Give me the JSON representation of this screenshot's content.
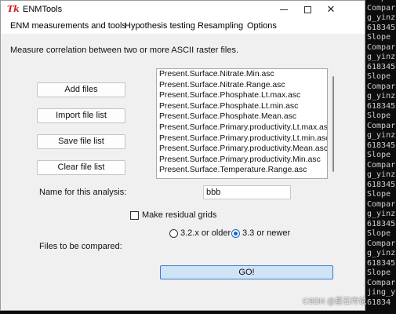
{
  "window": {
    "app_icon_glyph": "Tk",
    "title": "ENMTools",
    "controls": {
      "minimize": "—",
      "maximize": "☐",
      "close": "✕"
    }
  },
  "menu": [
    "ENM measurements and tools",
    "Hypothesis testing",
    "Resampling",
    "Options"
  ],
  "description": "Measure correlation between two or more ASCII raster files.",
  "buttons": {
    "add_files": "Add files",
    "import_file_list": "Import file list",
    "save_file_list": "Save file list",
    "clear_file_list": "Clear file list",
    "go": "GO!"
  },
  "file_list": [
    "Present.Surface.Nitrate.Min.asc",
    "Present.Surface.Nitrate.Range.asc",
    "Present.Surface.Phosphate.Lt.max.asc",
    "Present.Surface.Phosphate.Lt.min.asc",
    "Present.Surface.Phosphate.Mean.asc",
    "Present.Surface.Primary.productivity.Lt.max.asc",
    "Present.Surface.Primary.productivity.Lt.min.asc",
    "Present.Surface.Primary.productivity.Mean.asc",
    "Present.Surface.Primary.productivity.Min.asc",
    "Present.Surface.Temperature.Range.asc"
  ],
  "analysis_name": {
    "label": "Name for this analysis:",
    "value": "bbb"
  },
  "residual_grids": {
    "label": "Make residual grids",
    "checked": false
  },
  "version": {
    "options": [
      "3.2.x or older",
      "3.3 or newer"
    ],
    "selected": "3.3 or newer"
  },
  "files_compared_label": "Files to be compared:",
  "console_lines": [
    "Slope",
    "Compar",
    "g_yinz",
    "618345",
    "Slope",
    "Compar",
    "g_yinz",
    "618345",
    "Slope",
    "Compar",
    "g_yinz",
    "618345",
    "Slope",
    "Compar",
    "g_yinz",
    "618345",
    "Slope",
    "Compar",
    "g_yinz",
    "618345",
    "Slope",
    "Compar",
    "g_yinz",
    "618345",
    "Slope",
    "Compar",
    "g_yinz",
    "618345",
    "Slope",
    "Compar",
    "jing_y",
    "61834"
  ],
  "watermark": "CSDN @星石传说"
}
